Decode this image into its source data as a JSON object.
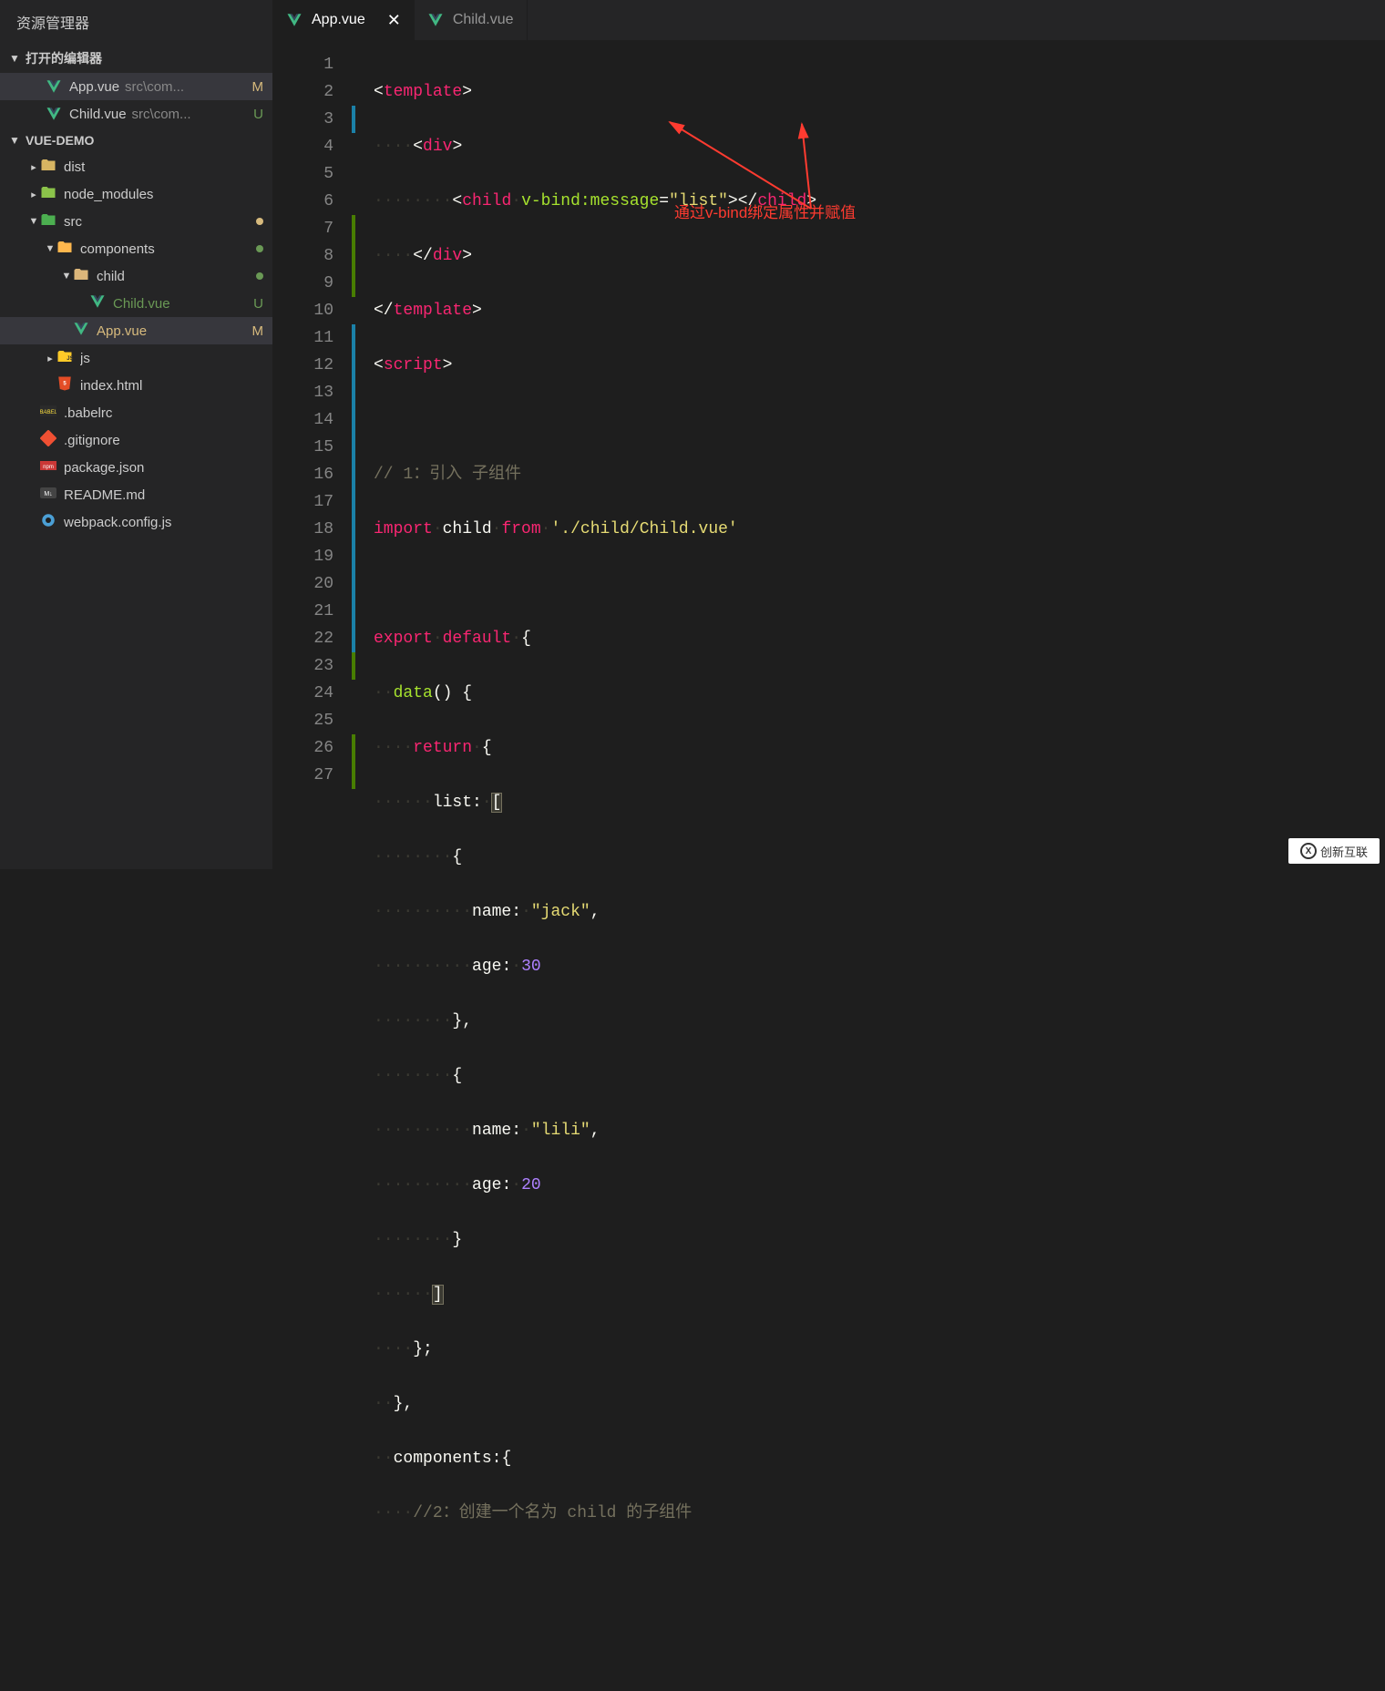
{
  "sidebar": {
    "title": "资源管理器",
    "openEditors": {
      "header": "打开的编辑器",
      "items": [
        {
          "label": "App.vue",
          "path": "src\\com...",
          "badge": "M",
          "status": "modified"
        },
        {
          "label": "Child.vue",
          "path": "src\\com...",
          "badge": "U",
          "status": "untracked"
        }
      ]
    },
    "project": "VUE-DEMO",
    "tree": [
      {
        "indent": 0,
        "chevron": "right",
        "icon": "folder-dist",
        "label": "dist"
      },
      {
        "indent": 0,
        "chevron": "right",
        "icon": "folder-node",
        "label": "node_modules"
      },
      {
        "indent": 0,
        "chevron": "down",
        "icon": "folder-src",
        "label": "src",
        "dot": "modified"
      },
      {
        "indent": 1,
        "chevron": "down",
        "icon": "folder-components",
        "label": "components",
        "dot": "untracked"
      },
      {
        "indent": 2,
        "chevron": "down",
        "icon": "folder-open",
        "label": "child",
        "dot": "untracked"
      },
      {
        "indent": 3,
        "chevron": "",
        "icon": "vue",
        "label": "Child.vue",
        "badge": "U",
        "status": "untracked"
      },
      {
        "indent": 2,
        "chevron": "",
        "icon": "vue",
        "label": "App.vue",
        "badge": "M",
        "status": "modified",
        "active": true
      },
      {
        "indent": 1,
        "chevron": "right",
        "icon": "folder-js",
        "label": "js"
      },
      {
        "indent": 1,
        "chevron": "",
        "icon": "html",
        "label": "index.html"
      },
      {
        "indent": 0,
        "chevron": "",
        "icon": "babel",
        "label": ".babelrc"
      },
      {
        "indent": 0,
        "chevron": "",
        "icon": "git",
        "label": ".gitignore"
      },
      {
        "indent": 0,
        "chevron": "",
        "icon": "npm",
        "label": "package.json"
      },
      {
        "indent": 0,
        "chevron": "",
        "icon": "md",
        "label": "README.md"
      },
      {
        "indent": 0,
        "chevron": "",
        "icon": "js",
        "label": "webpack.config.js"
      }
    ]
  },
  "tabs": [
    {
      "label": "App.vue",
      "active": true,
      "close": "✕"
    },
    {
      "label": "Child.vue",
      "active": false,
      "close": ""
    }
  ],
  "lineNumbers": [
    "1",
    "2",
    "3",
    "4",
    "5",
    "6",
    "7",
    "8",
    "9",
    "10",
    "11",
    "12",
    "13",
    "14",
    "15",
    "16",
    "17",
    "18",
    "19",
    "20",
    "21",
    "22",
    "23",
    "24",
    "25",
    "26",
    "27"
  ],
  "code": {
    "l1": {
      "tag": "template"
    },
    "l2": {
      "tag": "div"
    },
    "l3": {
      "tag": "child",
      "attr": "v-bind:message",
      "val": "\"list\""
    },
    "l4": {
      "tag": "div"
    },
    "l5": {
      "tag": "template"
    },
    "l6": {
      "tag": "script"
    },
    "l8": {
      "comment": "// 1：引入 子组件"
    },
    "l9": {
      "kw": "import",
      "ident": "child",
      "kw2": "from",
      "str": "'./child/Child.vue'"
    },
    "l11": {
      "kw1": "export",
      "kw2": "default",
      "brace": "{"
    },
    "l12": {
      "func": "data",
      "rest": "() {"
    },
    "l13": {
      "kw": "return",
      "brace": "{"
    },
    "l14": {
      "prop": "list",
      "punc": ":",
      "bracket": "["
    },
    "l15": {
      "brace": "{"
    },
    "l16": {
      "prop": "name",
      "val": "\"jack\"",
      "comma": ","
    },
    "l17": {
      "prop": "age",
      "val": "30"
    },
    "l18": {
      "brace": "},"
    },
    "l19": {
      "brace": "{"
    },
    "l20": {
      "prop": "name",
      "val": "\"lili\"",
      "comma": ","
    },
    "l21": {
      "prop": "age",
      "val": "20"
    },
    "l22": {
      "brace": "}"
    },
    "l23": {
      "bracket": "]"
    },
    "l24": {
      "brace": "};"
    },
    "l25": {
      "brace": "},"
    },
    "l26": {
      "prop": "components",
      "punc": ":",
      "brace": "{"
    },
    "l27": {
      "comment": "//2：创建一个名为 child 的子组件"
    }
  },
  "annotation": {
    "text": "通过v-bind绑定属性并赋值"
  },
  "watermark": {
    "text": "创新互联",
    "initial": "X"
  }
}
